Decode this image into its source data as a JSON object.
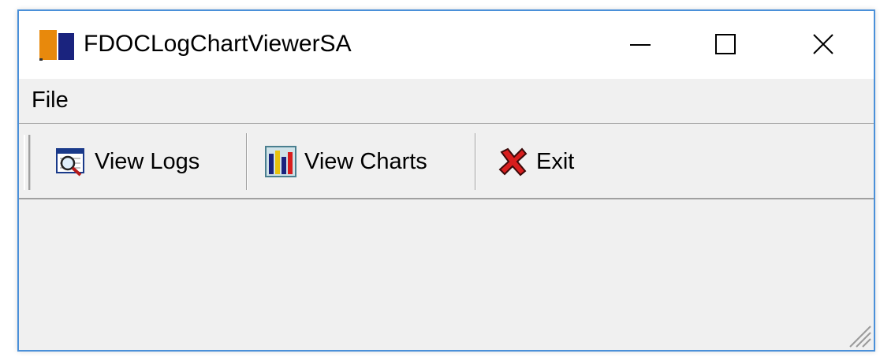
{
  "window": {
    "title": "FDOCLogChartViewerSA",
    "app_icon": "book-icon",
    "controls": [
      "minimize-icon",
      "maximize-icon",
      "close-icon"
    ]
  },
  "menu": {
    "file_label": "File"
  },
  "toolbar": {
    "view_logs_label": "View Logs",
    "view_logs_icon": "magnifier-document-icon",
    "view_charts_label": "View Charts",
    "view_charts_icon": "bar-chart-icon",
    "exit_label": "Exit",
    "exit_icon": "red-x-icon"
  },
  "colors": {
    "accent_border": "#4a90d9",
    "icon_orange": "#e8890c",
    "icon_navy": "#1a237e",
    "exit_red": "#d81e1e"
  }
}
